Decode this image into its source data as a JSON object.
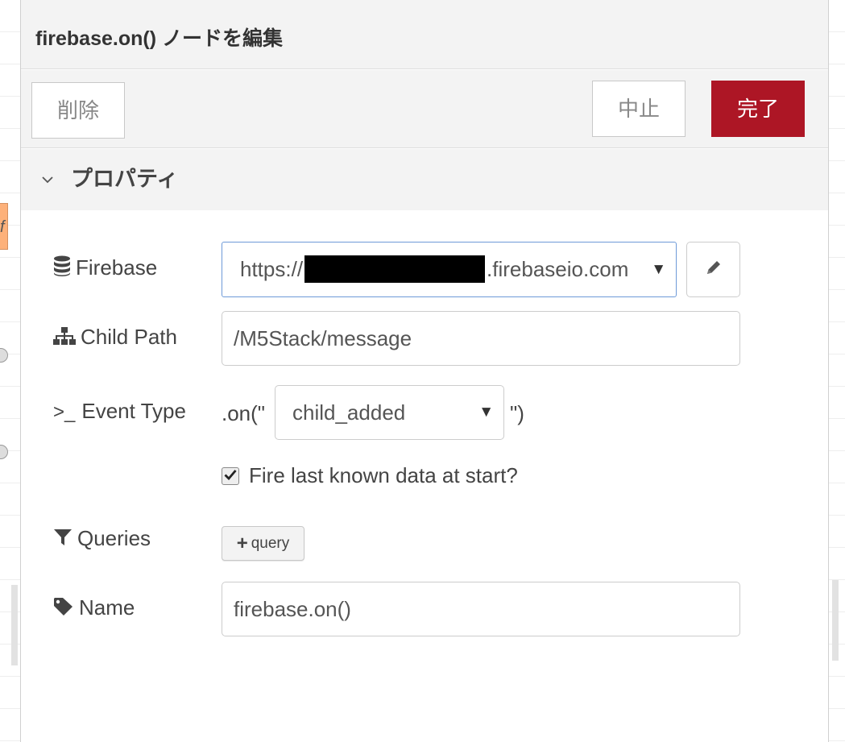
{
  "dialog": {
    "title": "firebase.on() ノードを編集"
  },
  "toolbar": {
    "delete_label": "削除",
    "cancel_label": "中止",
    "done_label": "完了"
  },
  "section": {
    "title": "プロパティ",
    "chevron_icon": "chevron-down-icon"
  },
  "form": {
    "firebase": {
      "label": "Firebase",
      "icon": "database-icon",
      "value_prefix": "https://",
      "value_suffix": ".firebaseio.com",
      "edit_icon": "pencil-icon"
    },
    "child_path": {
      "label": "Child Path",
      "icon": "sitemap-icon",
      "value": "/M5Stack/message"
    },
    "event_type": {
      "label": "Event Type",
      "icon": "terminal-icon",
      "icon_text": ">_",
      "prefix": ".on(\"",
      "value": "child_added",
      "suffix": "\")"
    },
    "fire_last": {
      "checked": true,
      "label": "Fire last known data at start?"
    },
    "queries": {
      "label": "Queries",
      "icon": "filter-icon",
      "button_label": "query"
    },
    "name": {
      "label": "Name",
      "icon": "tag-icon",
      "value": "firebase.on()"
    }
  },
  "colors": {
    "primary": "#ad1625",
    "focus_border": "#6e9ad8",
    "panel_bg": "#f3f3f3"
  }
}
